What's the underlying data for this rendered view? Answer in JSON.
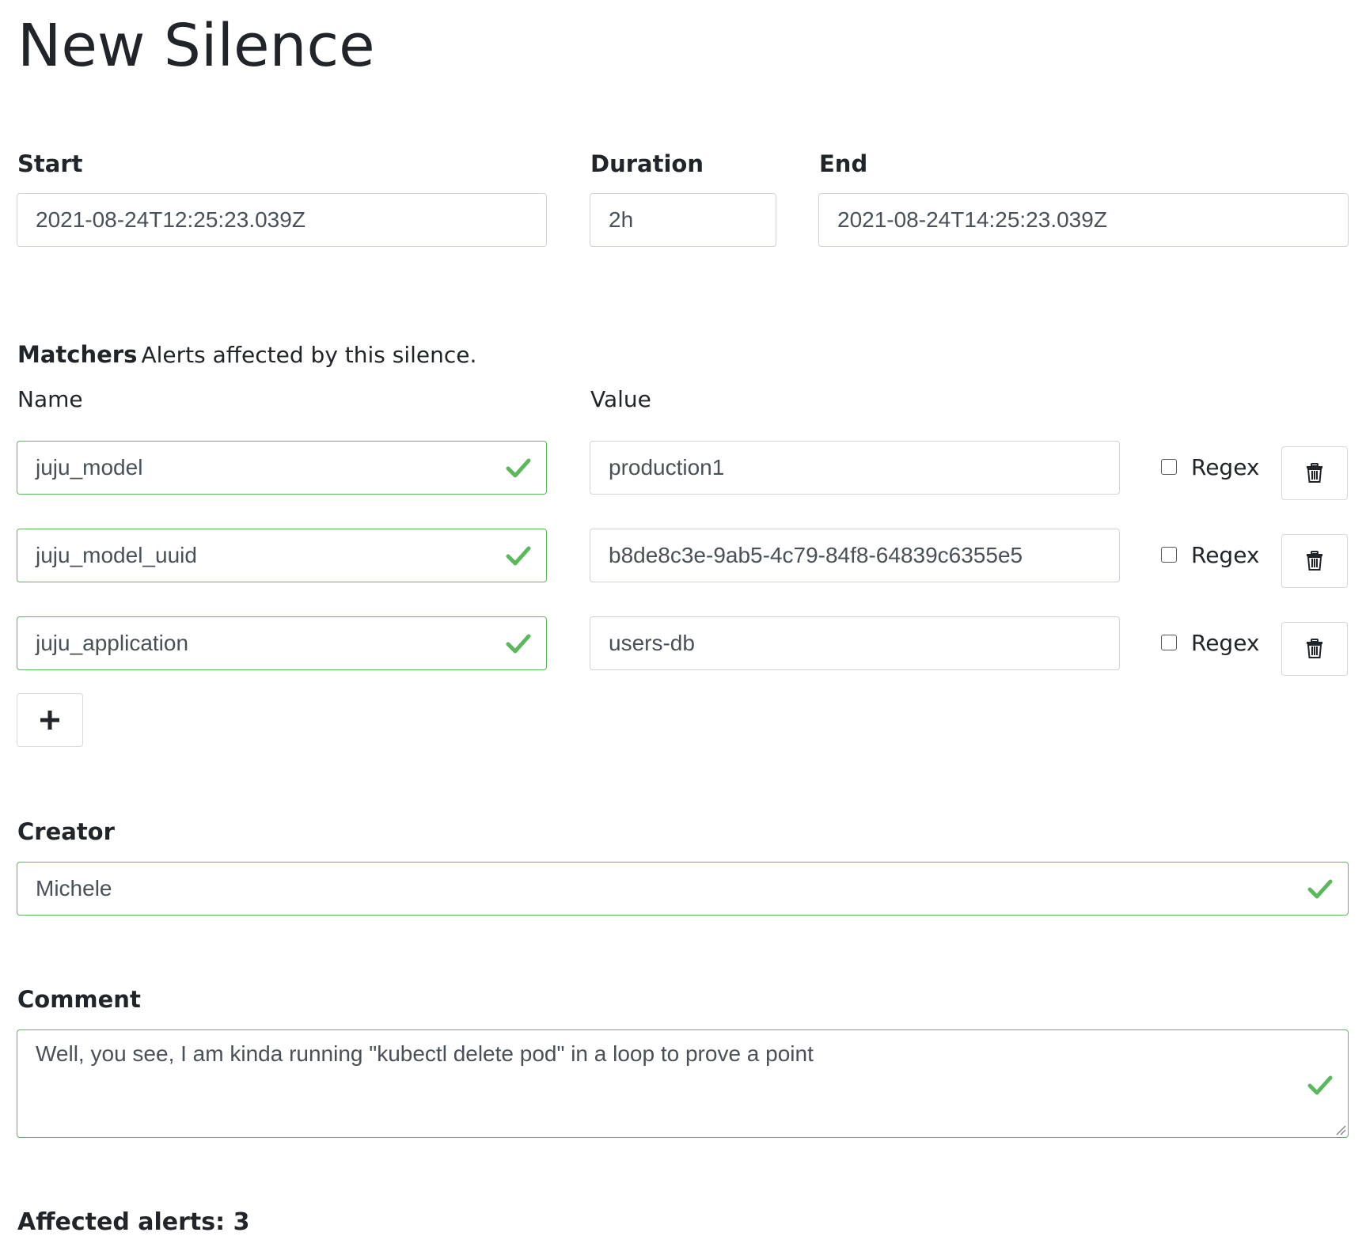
{
  "page": {
    "title": "New Silence"
  },
  "timing": {
    "start_label": "Start",
    "start_value": "2021-08-24T12:25:23.039Z",
    "duration_label": "Duration",
    "duration_value": "2h",
    "end_label": "End",
    "end_value": "2021-08-24T14:25:23.039Z"
  },
  "matchers": {
    "heading": "Matchers",
    "description": "Alerts affected by this silence.",
    "name_header": "Name",
    "value_header": "Value",
    "rows": [
      {
        "name": "juju_model",
        "value": "production1",
        "regex_label": "Regex",
        "regex_checked": false
      },
      {
        "name": "juju_model_uuid",
        "value": "b8de8c3e-9ab5-4c79-84f8-64839c6355e5",
        "regex_label": "Regex",
        "regex_checked": false
      },
      {
        "name": "juju_application",
        "value": "users-db",
        "regex_label": "Regex",
        "regex_checked": false
      }
    ],
    "add_button_icon": "plus-icon",
    "delete_button_icon": "trash-icon"
  },
  "creator": {
    "label": "Creator",
    "value": "Michele"
  },
  "comment": {
    "label": "Comment",
    "value": "Well, you see, I am kinda running \"kubectl delete pod\" in a loop to prove a point"
  },
  "affected": {
    "label": "Affected alerts: 3"
  },
  "colors": {
    "valid": "#5cb85c",
    "text": "#212529",
    "input_text": "#495057",
    "border": "#ced4da"
  }
}
